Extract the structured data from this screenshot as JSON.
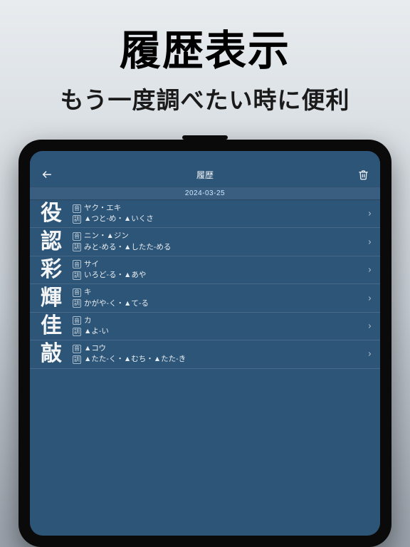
{
  "marketing": {
    "title": "履歴表示",
    "subtitle": "もう一度調べたい時に便利"
  },
  "header": {
    "title": "履歴"
  },
  "date": "2024-03-25",
  "badges": {
    "on": "音",
    "kun": "訓"
  },
  "entries": [
    {
      "kanji": "役",
      "on": "ヤク・エキ",
      "kun": "▲つと-め・▲いくさ"
    },
    {
      "kanji": "認",
      "on": "ニン・▲ジン",
      "kun": "みと-める・▲したた-める"
    },
    {
      "kanji": "彩",
      "on": "サイ",
      "kun": "いろど-る・▲あや"
    },
    {
      "kanji": "輝",
      "on": "キ",
      "kun": "かがや-く・▲て-る"
    },
    {
      "kanji": "佳",
      "on": "カ",
      "kun": "▲よ-い"
    },
    {
      "kanji": "敲",
      "on": "▲コウ",
      "kun": "▲たた-く・▲むち・▲たた-き"
    }
  ]
}
